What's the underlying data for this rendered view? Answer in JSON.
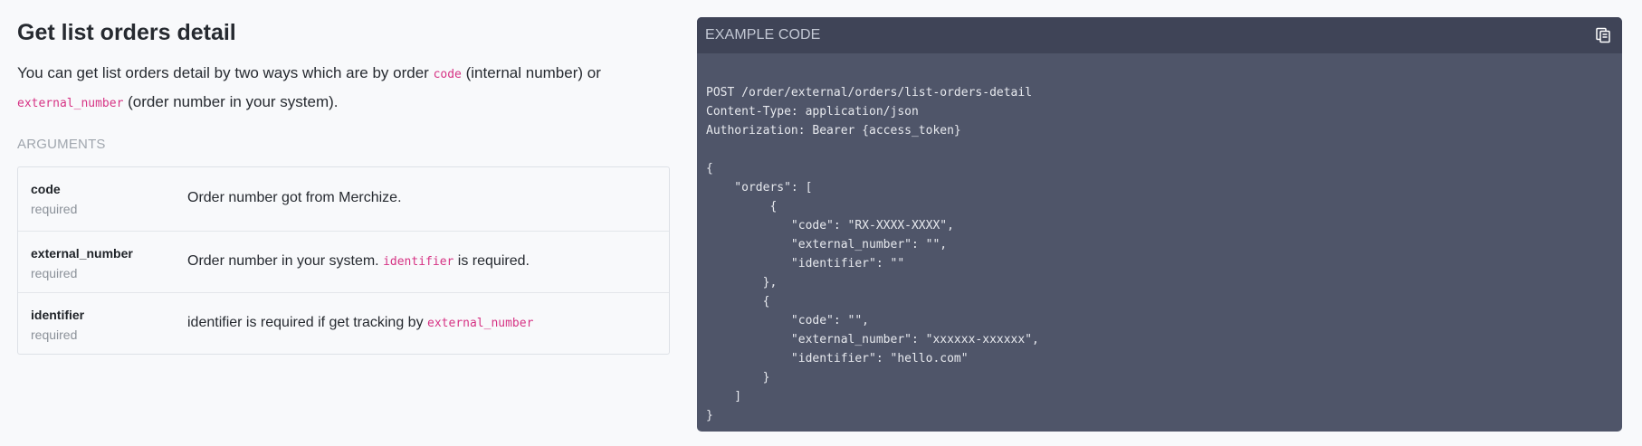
{
  "section": {
    "title": "Get list orders detail",
    "intro": {
      "part1": "You can get list orders detail by two ways which are by order ",
      "code1": "code",
      "part2": " (internal number) or ",
      "code2": "external_number",
      "part3": " (order number in your system)."
    }
  },
  "arguments": {
    "heading": "ARGUMENTS",
    "rows": [
      {
        "name": "code",
        "required": "required",
        "desc_text": "Order number got from Merchize.",
        "desc_code": "",
        "desc_after": ""
      },
      {
        "name": "external_number",
        "required": "required",
        "desc_text": "Order number in your system. ",
        "desc_code": "identifier",
        "desc_after": " is required."
      },
      {
        "name": "identifier",
        "required": "required",
        "desc_text": "identifier is required if get tracking by ",
        "desc_code": "external_number",
        "desc_after": ""
      }
    ]
  },
  "example": {
    "title": "EXAMPLE CODE",
    "copy_icon": "copy-icon",
    "code": "POST /order/external/orders/list-orders-detail\nContent-Type: application/json\nAuthorization: Bearer {access_token}\n\n{\n    \"orders\": [\n         {\n            \"code\": \"RX-XXXX-XXXX\",\n            \"external_number\": \"\",\n            \"identifier\": \"\"\n        },\n        {\n            \"code\": \"\",\n            \"external_number\": \"xxxxxx-xxxxxx\",\n            \"identifier\": \"hello.com\"\n        }\n    ]\n}"
  },
  "colors": {
    "code_bg": "#4f5569",
    "code_header_bg": "#3f4457",
    "inline_code": "#d63384",
    "page_bg": "#f8f9fb"
  }
}
